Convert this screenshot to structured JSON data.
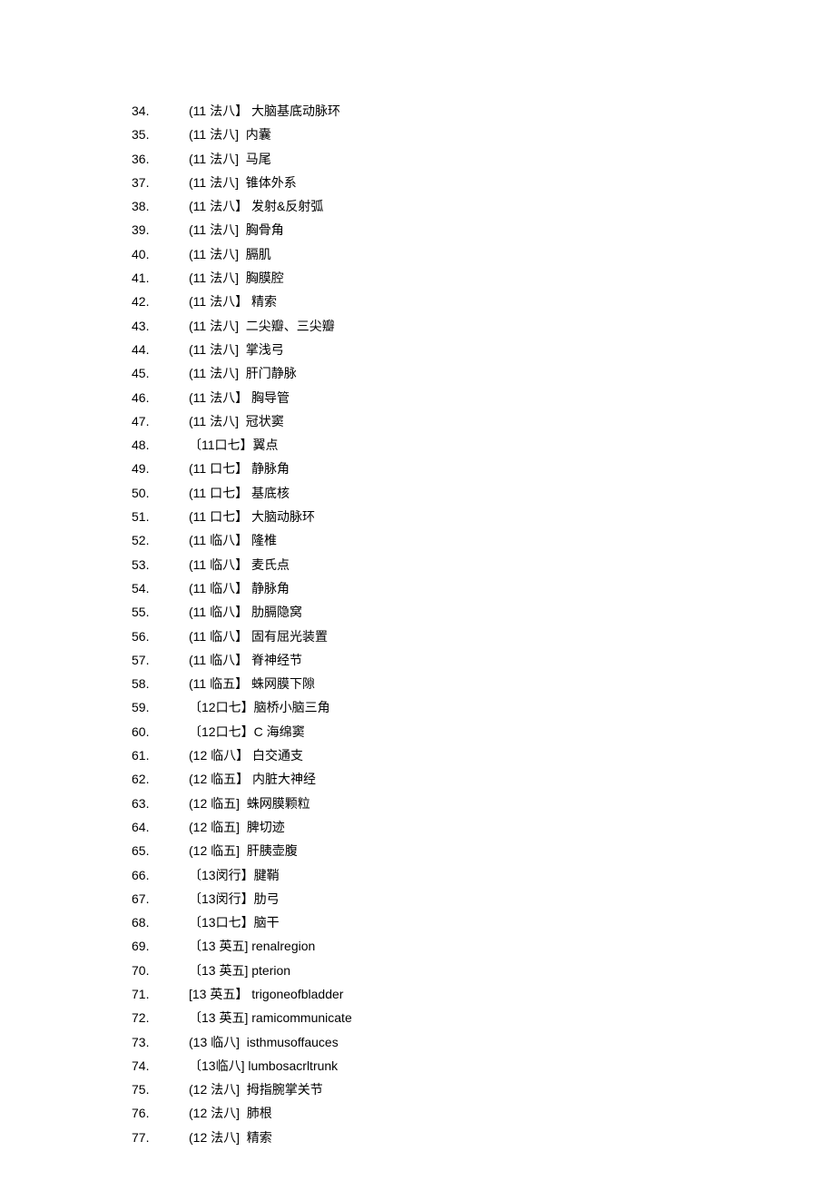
{
  "items": [
    {
      "num": "34.",
      "tag": "(11 法八】",
      "desc": " 大脑基底动脉环"
    },
    {
      "num": "35.",
      "tag": "(11 法八]",
      "desc": "  内囊"
    },
    {
      "num": "36.",
      "tag": "(11 法八]",
      "desc": "  马尾"
    },
    {
      "num": "37.",
      "tag": "(11 法八]",
      "desc": "  锥体外系"
    },
    {
      "num": "38.",
      "tag": "(11 法八】",
      "desc": " 发射&反射弧"
    },
    {
      "num": "39.",
      "tag": "(11 法八]",
      "desc": "  胸骨角"
    },
    {
      "num": "40.",
      "tag": "(11 法八]",
      "desc": "  膈肌"
    },
    {
      "num": "41.",
      "tag": "(11 法八]",
      "desc": "  胸膜腔"
    },
    {
      "num": "42.",
      "tag": "(11 法八】",
      "desc": " 精索"
    },
    {
      "num": "43.",
      "tag": "(11 法八]",
      "desc": "  二尖瓣、三尖瓣"
    },
    {
      "num": "44.",
      "tag": "(11 法八]",
      "desc": "  掌浅弓"
    },
    {
      "num": "45.",
      "tag": "(11 法八]",
      "desc": "  肝门静脉"
    },
    {
      "num": "46.",
      "tag": "(11 法八】",
      "desc": " 胸导管"
    },
    {
      "num": "47.",
      "tag": "(11 法八]",
      "desc": "  冠状窦"
    },
    {
      "num": "48.",
      "tag": "〔11口七】",
      "desc": "翼点"
    },
    {
      "num": "49.",
      "tag": "(11 口七】",
      "desc": " 静脉角"
    },
    {
      "num": "50.",
      "tag": "(11 口七】",
      "desc": " 基底核"
    },
    {
      "num": "51.",
      "tag": "(11 口七】",
      "desc": " 大脑动脉环"
    },
    {
      "num": "52.",
      "tag": "(11 临八】",
      "desc": " 隆椎"
    },
    {
      "num": "53.",
      "tag": "(11 临八】",
      "desc": " 麦氏点"
    },
    {
      "num": "54.",
      "tag": "(11 临八】",
      "desc": " 静脉角"
    },
    {
      "num": "55.",
      "tag": "(11 临八】",
      "desc": " 肋膈隐窝"
    },
    {
      "num": "56.",
      "tag": "(11 临八】",
      "desc": " 固有屈光装置"
    },
    {
      "num": "57.",
      "tag": "(11 临八】",
      "desc": " 脊神经节"
    },
    {
      "num": "58.",
      "tag": "(11 临五】",
      "desc": " 蛛网膜下隙"
    },
    {
      "num": "59.",
      "tag": "〔12口七】",
      "desc": "脑桥小脑三角"
    },
    {
      "num": "60.",
      "tag": "〔12口七】",
      "desc": "C 海绵窦"
    },
    {
      "num": "61.",
      "tag": "(12 临八】",
      "desc": " 白交通支"
    },
    {
      "num": "62.",
      "tag": "(12 临五】",
      "desc": " 内脏大神经"
    },
    {
      "num": "63.",
      "tag": "(12 临五]",
      "desc": "  蛛网膜颗粒"
    },
    {
      "num": "64.",
      "tag": "(12 临五]",
      "desc": "  脾切迹"
    },
    {
      "num": "65.",
      "tag": "(12 临五]",
      "desc": "  肝胰壶腹"
    },
    {
      "num": "66.",
      "tag": "〔13闵行】",
      "desc": "腱鞘"
    },
    {
      "num": "67.",
      "tag": "〔13闵行】",
      "desc": "肋弓"
    },
    {
      "num": "68.",
      "tag": "〔13口七】",
      "desc": "脑干"
    },
    {
      "num": "69.",
      "tag": "〔13 英五]",
      "desc": " renalregion"
    },
    {
      "num": "70.",
      "tag": "〔13 英五]",
      "desc": " pterion"
    },
    {
      "num": "71.",
      "tag": "[13 英五】",
      "desc": " trigoneofbladder"
    },
    {
      "num": "72.",
      "tag": "〔13 英五]",
      "desc": " ramicommunicate"
    },
    {
      "num": "73.",
      "tag": "(13 临八]",
      "desc": "  isthmusoffauces"
    },
    {
      "num": "74.",
      "tag": "〔13临八]",
      "desc": " lumbosacrltrunk"
    },
    {
      "num": "75.",
      "tag": "(12 法八]",
      "desc": "  拇指腕掌关节"
    },
    {
      "num": "76.",
      "tag": "(12 法八]",
      "desc": "  肺根"
    },
    {
      "num": "77.",
      "tag": "(12 法八]",
      "desc": "  精索"
    }
  ]
}
